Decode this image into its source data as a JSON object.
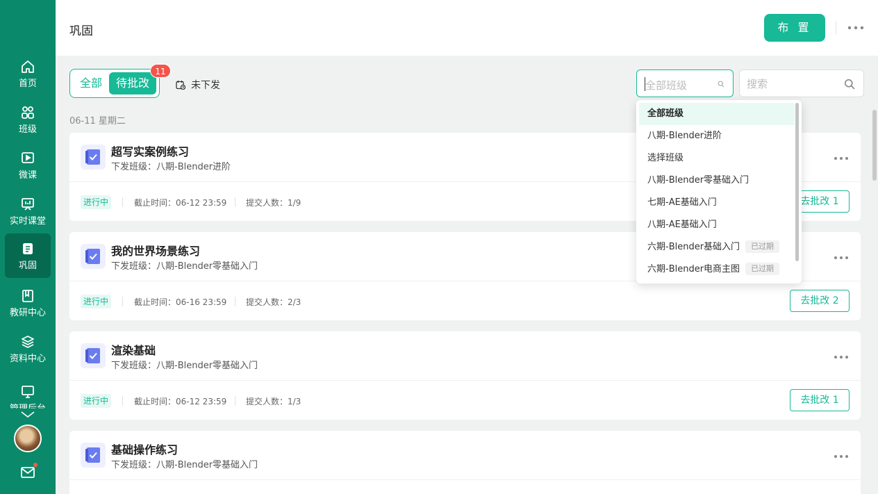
{
  "sidebar": {
    "items": [
      {
        "label": "首页",
        "icon": "home-icon"
      },
      {
        "label": "班级",
        "icon": "users-icon"
      },
      {
        "label": "微课",
        "icon": "play-board-icon"
      },
      {
        "label": "实时课堂",
        "icon": "presentation-icon"
      },
      {
        "label": "巩固",
        "icon": "notebook-icon"
      },
      {
        "label": "教研中心",
        "icon": "book-icon"
      },
      {
        "label": "资料中心",
        "icon": "layers-icon"
      },
      {
        "label": "管理后台",
        "icon": "monitor-icon"
      }
    ],
    "active": "巩固"
  },
  "header": {
    "title": "巩固",
    "publish_label": "布 置"
  },
  "filters": {
    "tab_all": "全部",
    "tab_pending": "待批改",
    "pending_count": "11",
    "unsent_label": "未下发",
    "class_placeholder": "全部班级",
    "search_placeholder": "搜索"
  },
  "date_group": "06-11 星期二",
  "cards": [
    {
      "title": "超写实案例练习",
      "classes": "下发班级：八期-Blender进阶",
      "status": "进行中",
      "deadline": "截止时间：06-12 23:59",
      "submitted": "提交人数：1/9",
      "review": "去批改 1"
    },
    {
      "title": "我的世界场景练习",
      "classes": "下发班级：八期-Blender零基础入门",
      "status": "进行中",
      "deadline": "截止时间：06-16 23:59",
      "submitted": "提交人数：2/3",
      "review": "去批改 2"
    },
    {
      "title": "渲染基础",
      "classes": "下发班级：八期-Blender零基础入门",
      "status": "进行中",
      "deadline": "截止时间：06-12 23:59",
      "submitted": "提交人数：1/3",
      "review": "去批改 1"
    },
    {
      "title": "基础操作练习",
      "classes": "下发班级：八期-Blender零基础入门",
      "status": "",
      "deadline": "",
      "submitted": "",
      "review": ""
    }
  ],
  "class_dropdown": {
    "options": [
      {
        "label": "全部班级",
        "tag": ""
      },
      {
        "label": "八期-Blender进阶",
        "tag": ""
      },
      {
        "label": "选择班级",
        "tag": ""
      },
      {
        "label": "八期-Blender零基础入门",
        "tag": ""
      },
      {
        "label": "七期-AE基础入门",
        "tag": ""
      },
      {
        "label": "八期-AE基础入门",
        "tag": ""
      },
      {
        "label": "六期-Blender基础入门",
        "tag": "已过期"
      },
      {
        "label": "六期-Blender电商主图",
        "tag": "已过期"
      }
    ],
    "selected": "全部班级"
  },
  "colors": {
    "sidebar": "#0a8a6a",
    "accent": "#17b997",
    "badge": "#f4544c"
  }
}
